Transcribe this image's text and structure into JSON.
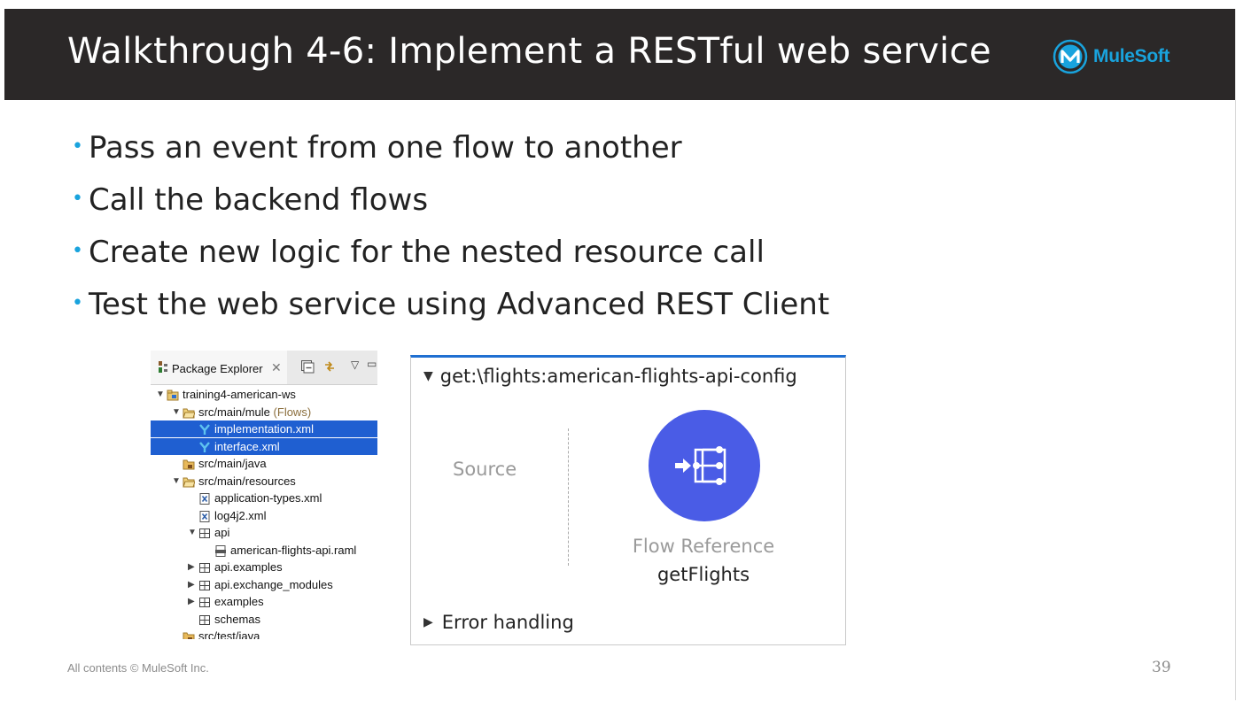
{
  "slide": {
    "title": "Walkthrough 4-6: Implement a RESTful web service",
    "logo_text": "MuleSoft",
    "brand_color": "#19a3dd",
    "bullets": [
      "Pass an event from one flow to another",
      "Call the backend flows",
      "Create new logic for the nested resource call",
      "Test the web service using Advanced REST Client"
    ],
    "footer": "All contents © MuleSoft Inc.",
    "page_number": "39"
  },
  "package_explorer": {
    "tab_label": "Package Explorer",
    "selection_color": "#1f5fd1",
    "items": [
      {
        "label": "training4-american-ws",
        "icon": "project-icon",
        "twisty": "open"
      },
      {
        "label": "src/main/mule",
        "suffix": "(Flows)",
        "icon": "open-folder-icon",
        "twisty": "open"
      },
      {
        "label": "implementation.xml",
        "icon": "mule-config-icon",
        "twisty": "",
        "selected": true
      },
      {
        "label": "interface.xml",
        "icon": "mule-config-icon",
        "twisty": "",
        "selected": true
      },
      {
        "label": "src/main/java",
        "icon": "source-folder-icon",
        "twisty": ""
      },
      {
        "label": "src/main/resources",
        "icon": "open-folder-icon",
        "twisty": "open"
      },
      {
        "label": "application-types.xml",
        "icon": "xml-file-icon",
        "twisty": ""
      },
      {
        "label": "log4j2.xml",
        "icon": "xml-file-icon",
        "twisty": ""
      },
      {
        "label": "api",
        "icon": "package-icon",
        "twisty": "open"
      },
      {
        "label": "american-flights-api.raml",
        "icon": "raml-file-icon",
        "twisty": ""
      },
      {
        "label": "api.examples",
        "icon": "package-icon",
        "twisty": "closed"
      },
      {
        "label": "api.exchange_modules",
        "icon": "package-icon",
        "twisty": "closed"
      },
      {
        "label": "examples",
        "icon": "package-icon",
        "twisty": "closed"
      },
      {
        "label": "schemas",
        "icon": "package-icon",
        "twisty": ""
      },
      {
        "label": "src/test/java",
        "icon": "source-folder-icon",
        "twisty": ""
      }
    ]
  },
  "flow": {
    "name": "get:\\flights:american-flights-api-config",
    "source_label": "Source",
    "component_type": "Flow Reference",
    "component_name": "getFlights",
    "component_color": "#4a5ce6",
    "error_handling_label": "Error handling"
  }
}
